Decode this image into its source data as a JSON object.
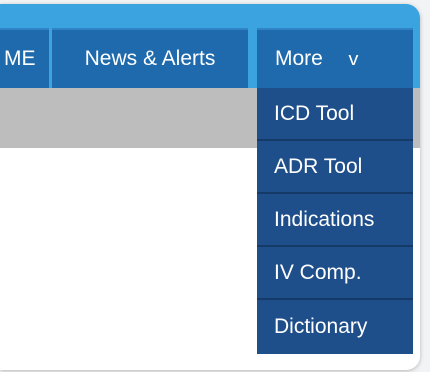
{
  "nav": {
    "items": [
      {
        "label": "ME"
      },
      {
        "label": "News & Alerts"
      },
      {
        "label": "More",
        "chevron": "v"
      }
    ]
  },
  "dropdown": {
    "items": [
      {
        "label": "ICD Tool"
      },
      {
        "label": "ADR Tool"
      },
      {
        "label": "Indications"
      },
      {
        "label": "IV Comp."
      },
      {
        "label": "Dictionary"
      }
    ]
  },
  "colors": {
    "navbar": "#3aa3e0",
    "nav_item": "#1e6aac",
    "dropdown_item": "#1f4f8a",
    "gray_bar": "#bdbdbd"
  }
}
